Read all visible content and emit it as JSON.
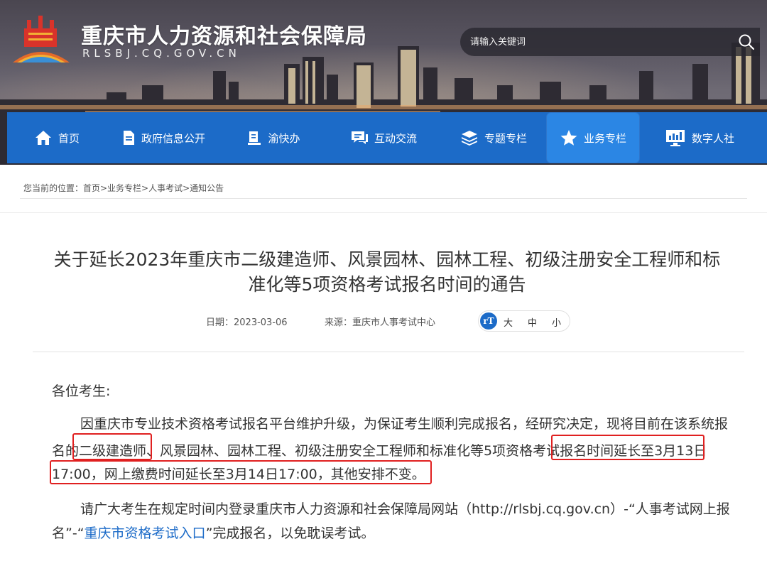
{
  "header": {
    "site_title": "重庆市人力资源和社会保障局",
    "site_domain": "RLSBJ.CQ.GOV.CN",
    "search_placeholder": "请输入关键词"
  },
  "nav": {
    "items": [
      {
        "label": "首页",
        "icon": "home-icon"
      },
      {
        "label": "政府信息公开",
        "icon": "document-icon"
      },
      {
        "label": "渝快办",
        "icon": "book-icon"
      },
      {
        "label": "互动交流",
        "icon": "chat-icon"
      },
      {
        "label": "专题专栏",
        "icon": "layers-icon"
      },
      {
        "label": "业务专栏",
        "icon": "star-icon",
        "active": true
      },
      {
        "label": "数字人社",
        "icon": "monitor-icon"
      }
    ]
  },
  "breadcrumb": {
    "text": "您当前的位置：首页>业务专栏>人事考试>通知公告"
  },
  "article": {
    "title_line1": "关于延长2023年重庆市二级建造师、风景园林、园林工程、初级注册安全工程师和标",
    "title_line2": "准化等5项资格考试报名时间的通告",
    "date": "日期：2023-03-06",
    "source": "来源：重庆市人事考试中心",
    "font_size_icon": "rT",
    "font_sizes": [
      "大",
      "中",
      "小"
    ],
    "greeting": "各位考生:",
    "p1_line1": "因重庆市专业技术资格考试报名平台维护升级，为保证考生顺利完成报名，经研究决定，现将目前在该系统报",
    "p1_line2": "名的二级建造师、风景园林、园林工程、初级注册安全工程师和标准化等5项资格考试报名时间延长至3月13日",
    "p1_line3": "17:00，网上缴费时间延长至3月14日17:00，其他安排不变。",
    "p2_line1": "请广大考生在规定时间内登录重庆市人力资源和社会保障局网站（http://rlsbj.cq.gov.cn）-“人事考试网上报",
    "p2_line2_a": "名”-“",
    "p2_line2_link": "重庆市资格考试入口",
    "p2_line2_b": "”完成报名，以免耽误考试。"
  },
  "colors": {
    "nav_blue": "#1c6bc8",
    "nav_active": "#2b86e4",
    "highlight_red": "#e02020",
    "link_blue": "#1c6bc8"
  }
}
